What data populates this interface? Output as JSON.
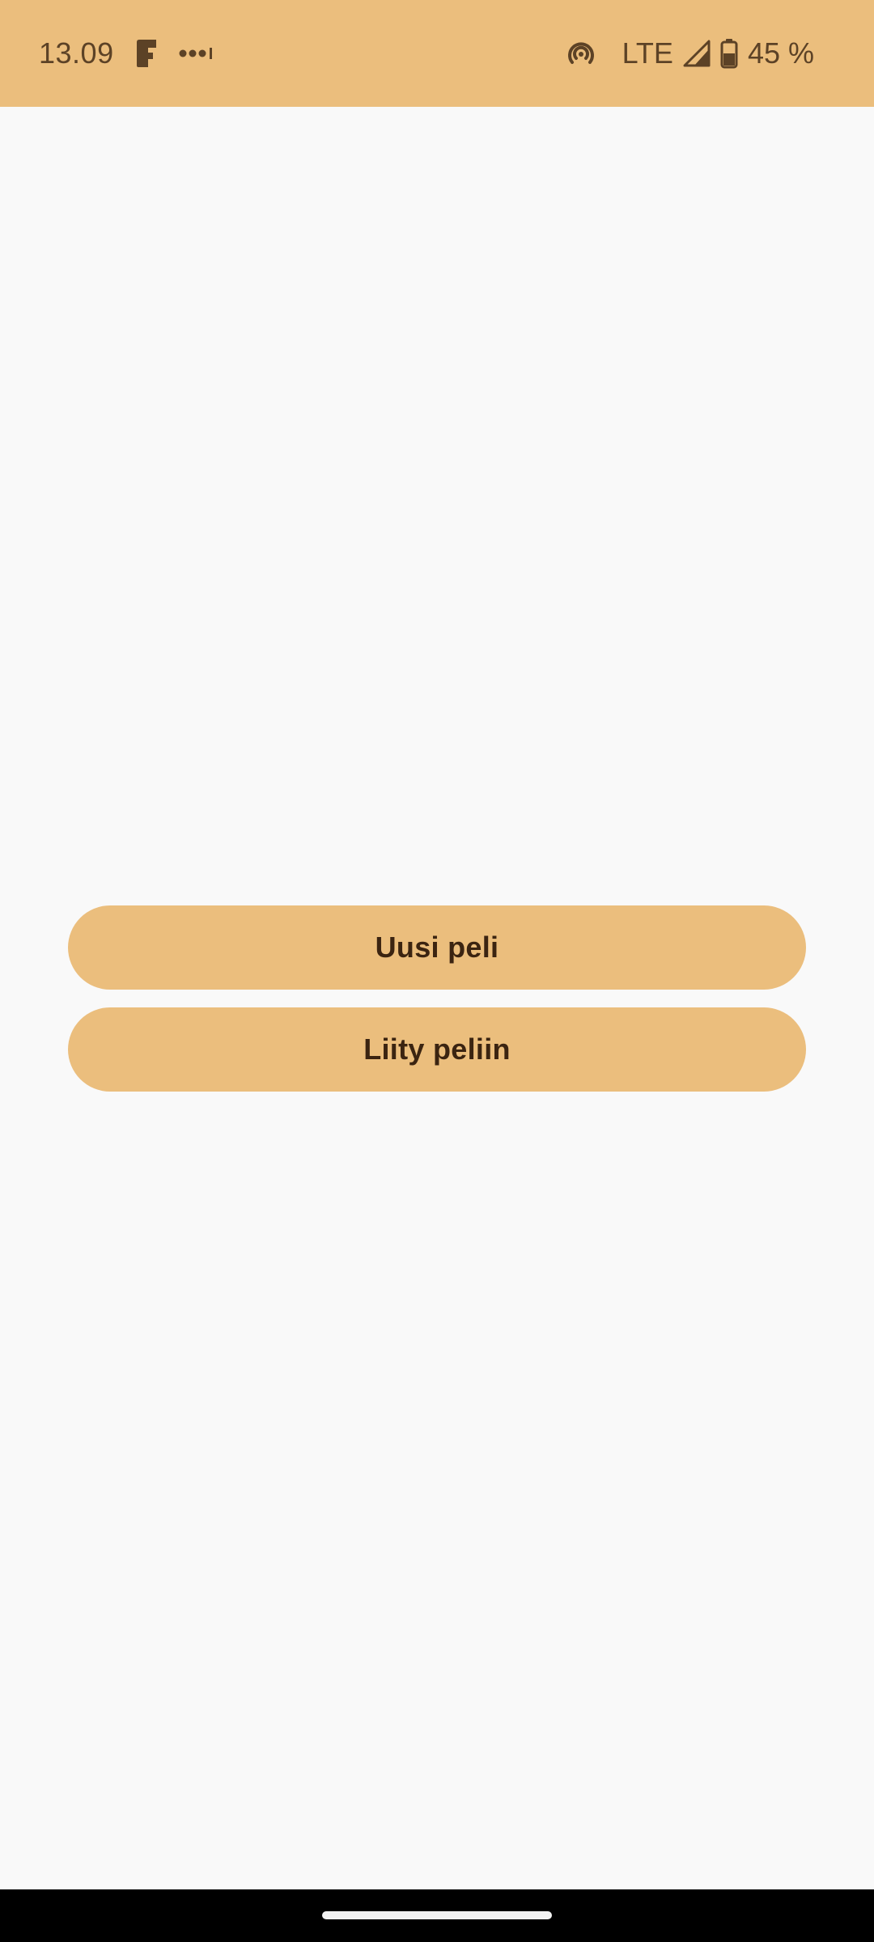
{
  "status_bar": {
    "time": "13.09",
    "network": "LTE",
    "battery": "45 %",
    "icons": [
      "app-notification-icon",
      "more-notifications-icon",
      "hotspot-icon",
      "signal-icon",
      "battery-icon"
    ],
    "background": "#ebbe7d"
  },
  "main": {
    "new_game_label": "Uusi peli",
    "join_game_label": "Liity peliin",
    "button_color": "#ebbe7d",
    "button_text_color": "#3b2411"
  },
  "nav_bar": {
    "background": "#000000"
  }
}
